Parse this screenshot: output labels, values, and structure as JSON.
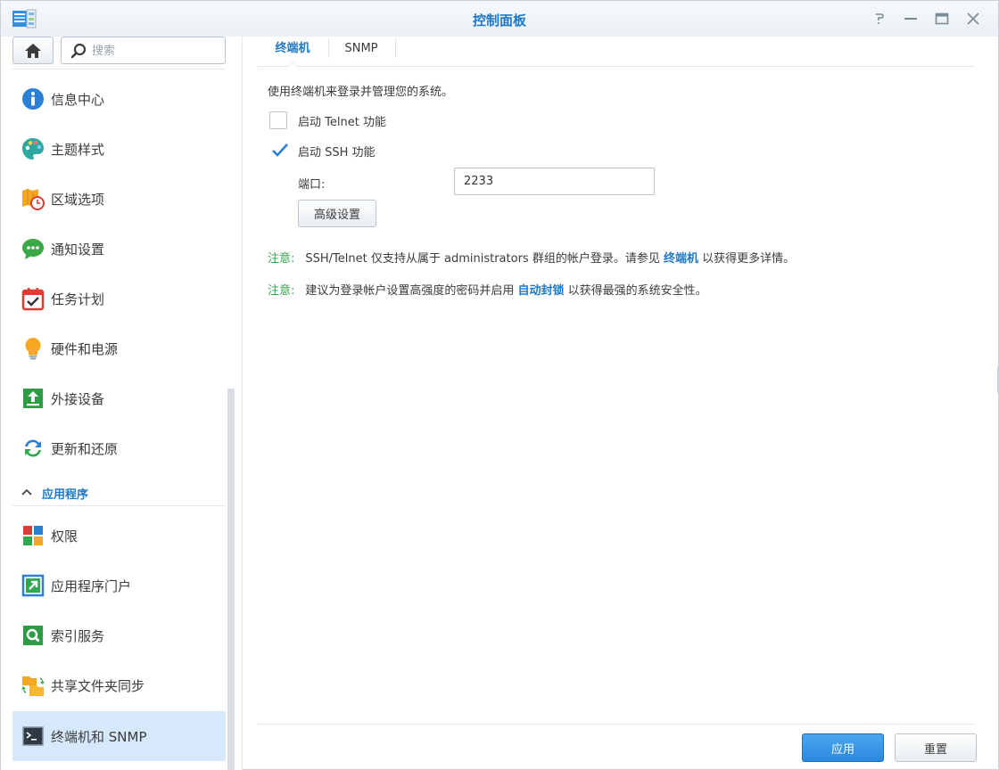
{
  "window": {
    "title": "控制面板"
  },
  "search": {
    "placeholder": "搜索"
  },
  "sidebar": {
    "items": [
      {
        "label": "信息中心",
        "icon": "info-icon"
      },
      {
        "label": "主题样式",
        "icon": "palette-icon"
      },
      {
        "label": "区域选项",
        "icon": "region-clock-icon"
      },
      {
        "label": "通知设置",
        "icon": "chat-bubble-icon"
      },
      {
        "label": "任务计划",
        "icon": "calendar-check-icon"
      },
      {
        "label": "硬件和电源",
        "icon": "lightbulb-icon"
      },
      {
        "label": "外接设备",
        "icon": "upload-device-icon"
      },
      {
        "label": "更新和还原",
        "icon": "refresh-icon"
      }
    ],
    "section": {
      "label": "应用程序"
    },
    "app_items": [
      {
        "label": "权限",
        "icon": "privileges-grid-icon"
      },
      {
        "label": "应用程序门户",
        "icon": "app-portal-icon"
      },
      {
        "label": "索引服务",
        "icon": "index-search-icon"
      },
      {
        "label": "共享文件夹同步",
        "icon": "folder-sync-icon"
      },
      {
        "label": "终端机和 SNMP",
        "icon": "terminal-icon",
        "active": true
      }
    ]
  },
  "tabs": [
    {
      "label": "终端机",
      "active": true
    },
    {
      "label": "SNMP",
      "active": false
    }
  ],
  "terminal": {
    "description": "使用终端机来登录并管理您的系统。",
    "telnet": {
      "label": "启动 Telnet 功能",
      "checked": false
    },
    "ssh": {
      "label": "启动 SSH 功能",
      "checked": true
    },
    "port_label": "端口:",
    "port_value": "2233",
    "advanced_button": "高级设置"
  },
  "notes": [
    {
      "tag": "注意:",
      "text_before": "SSH/Telnet 仅支持从属于 administrators 群组的帐户登录。请参见 ",
      "link": "终端机",
      "text_after": " 以获得更多详情。"
    },
    {
      "tag": "注意:",
      "text_before": "建议为登录帐户设置高强度的密码并启用 ",
      "link": "自动封锁",
      "text_after": " 以获得最强的系统安全性。"
    }
  ],
  "footer": {
    "apply_label": "应用",
    "reset_label": "重置"
  },
  "colors": {
    "accent": "#1f79c8",
    "note_tag": "#36a34a",
    "active_item_bg": "#d6e9fb",
    "apply_bg": "#2b88dc"
  }
}
